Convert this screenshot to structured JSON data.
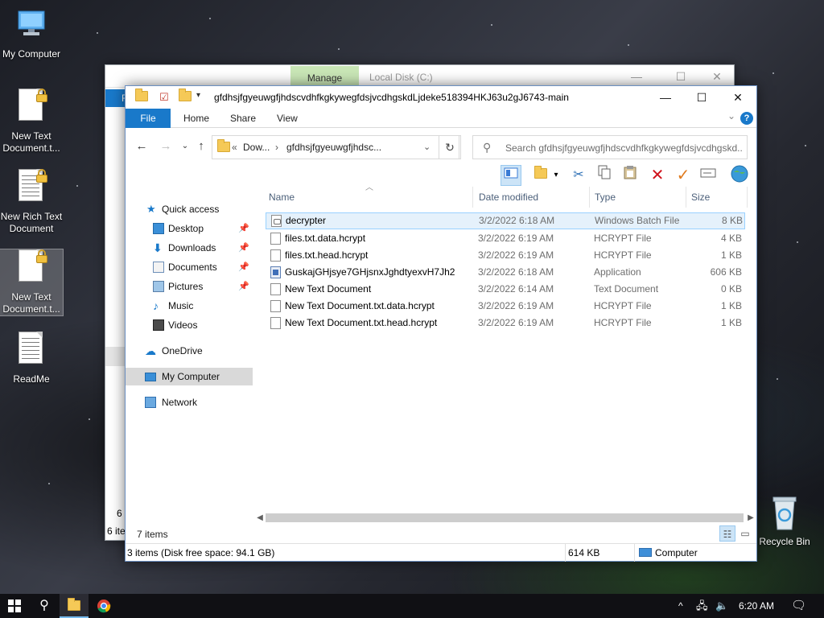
{
  "desktop": {
    "icons": [
      {
        "label": "My Computer",
        "icon": "computer-icon"
      },
      {
        "label": "New Text Document.t...",
        "icon": "locked-document-icon"
      },
      {
        "label": "New Rich Text Document",
        "icon": "locked-rich-text-icon"
      },
      {
        "label": "New Text Document.t...",
        "icon": "locked-document-icon"
      },
      {
        "label": "ReadMe",
        "icon": "text-document-icon"
      },
      {
        "label": "Recycle Bin",
        "icon": "recycle-bin-icon"
      }
    ]
  },
  "background_window": {
    "ribbon_context_tab": "Manage",
    "title": "Local Disk (C:)",
    "ribbon_file_fragment": "F",
    "count_fragment": "6 i",
    "status_fragment": "6 ite"
  },
  "window": {
    "title": "gfdhsjfgyeuwgfjhdscvdhfkgkywegfdsjvcdhgskdLjdeke518394HKJ63u2gJ6743-main",
    "controls": {
      "minimize": "—",
      "maximize": "☐",
      "close": "✕"
    },
    "ribbon_tabs": [
      "File",
      "Home",
      "Share",
      "View"
    ],
    "help": "?",
    "address": {
      "overflow": "«",
      "crumbs": [
        "Dow...",
        "gfdhsjfgyeuwgfjhdsc..."
      ],
      "separator": "›"
    },
    "search_placeholder": "Search gfdhsjfgyeuwgfjhdscvdhfkgkywegfdsjvcdhgskd...",
    "sidebar": [
      {
        "label": "Quick access",
        "icon": "star-icon",
        "pinned": false
      },
      {
        "label": "Desktop",
        "icon": "desktop-icon",
        "pinned": true
      },
      {
        "label": "Downloads",
        "icon": "download-arrow-icon",
        "pinned": true
      },
      {
        "label": "Documents",
        "icon": "documents-icon",
        "pinned": true
      },
      {
        "label": "Pictures",
        "icon": "pictures-icon",
        "pinned": true
      },
      {
        "label": "Music",
        "icon": "music-icon",
        "pinned": false
      },
      {
        "label": "Videos",
        "icon": "videos-icon",
        "pinned": false
      },
      {
        "label": "OneDrive",
        "icon": "cloud-icon",
        "pinned": false
      },
      {
        "label": "My Computer",
        "icon": "computer-icon",
        "pinned": false
      },
      {
        "label": "Network",
        "icon": "network-icon",
        "pinned": false
      }
    ],
    "columns": [
      "Name",
      "Date modified",
      "Type",
      "Size"
    ],
    "files": [
      {
        "name": "decrypter",
        "date": "3/2/2022 6:18 AM",
        "type": "Windows Batch File",
        "size": "8 KB",
        "icon": "batch-file-icon"
      },
      {
        "name": "files.txt.data.hcrypt",
        "date": "3/2/2022 6:19 AM",
        "type": "HCRYPT File",
        "size": "4 KB",
        "icon": "file-icon"
      },
      {
        "name": "files.txt.head.hcrypt",
        "date": "3/2/2022 6:19 AM",
        "type": "HCRYPT File",
        "size": "1 KB",
        "icon": "file-icon"
      },
      {
        "name": "GuskajGHjsye7GHjsnxJghdtyexvH7Jh2",
        "date": "3/2/2022 6:18 AM",
        "type": "Application",
        "size": "606 KB",
        "icon": "application-icon"
      },
      {
        "name": "New Text Document",
        "date": "3/2/2022 6:14 AM",
        "type": "Text Document",
        "size": "0 KB",
        "icon": "text-file-icon"
      },
      {
        "name": "New Text Document.txt.data.hcrypt",
        "date": "3/2/2022 6:19 AM",
        "type": "HCRYPT File",
        "size": "1 KB",
        "icon": "file-icon"
      },
      {
        "name": "New Text Document.txt.head.hcrypt",
        "date": "3/2/2022 6:19 AM",
        "type": "HCRYPT File",
        "size": "1 KB",
        "icon": "file-icon"
      }
    ],
    "items_count": "7 items",
    "status": {
      "selection": "3 items (Disk free space: 94.1 GB)",
      "size": "614 KB",
      "location": "Computer"
    }
  },
  "taskbar": {
    "time": "6:20 AM",
    "tray_chevron": "^"
  },
  "colors": {
    "accent": "#1979ca",
    "manage_tab": "#c9e6b6",
    "selection": "#e5f1fb",
    "nav_selected": "#d9d9d9"
  }
}
